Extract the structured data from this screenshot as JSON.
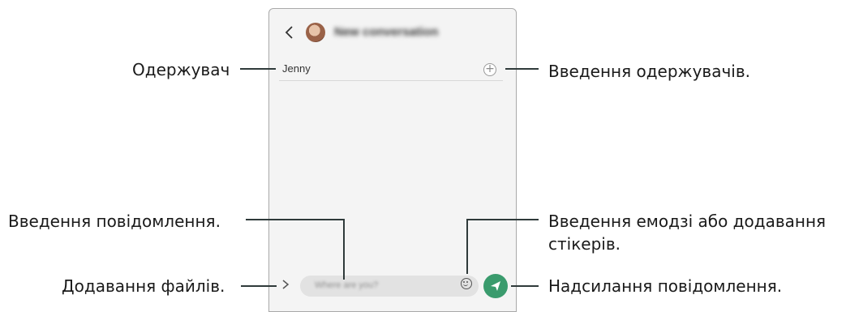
{
  "screen": {
    "header": {
      "back_icon": "chevron-left-icon",
      "title": "New conversation"
    },
    "recipient_field": {
      "value": "Jenny",
      "add_icon": "plus-circle-icon"
    },
    "composer": {
      "attach_icon": "chevron-right-icon",
      "placeholder": "Where are you?",
      "emoji_icon": "smiley-icon",
      "send_icon": "paper-plane-icon"
    },
    "accent_color": "#3a9b6d"
  },
  "callouts": {
    "recipient": "Одержувач",
    "enter_recipients": "Введення одержувачів.",
    "enter_message": "Введення повідомлення.",
    "emoji_stickers": "Введення емодзі або додавання стікерів.",
    "attach_files": "Додавання файлів.",
    "send_message": "Надсилання повідомлення."
  }
}
